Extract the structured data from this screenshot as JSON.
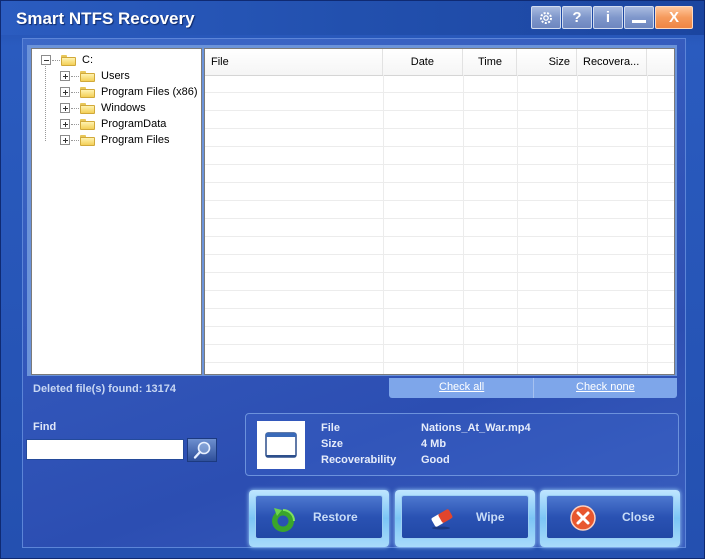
{
  "window": {
    "title": "Smart NTFS Recovery",
    "title_buttons": [
      {
        "name": "settings",
        "glyph": "⚙"
      },
      {
        "name": "help",
        "glyph": "?"
      },
      {
        "name": "info",
        "glyph": "i"
      },
      {
        "name": "minimize",
        "glyph": "_"
      },
      {
        "name": "close",
        "glyph": "X"
      }
    ]
  },
  "tree": {
    "root": {
      "label": "C:",
      "expanded": true
    },
    "children": [
      {
        "label": "Users"
      },
      {
        "label": "Program Files (x86)"
      },
      {
        "label": "Windows"
      },
      {
        "label": "ProgramData"
      },
      {
        "label": "Program Files"
      }
    ]
  },
  "grid": {
    "columns": [
      "File",
      "Date",
      "Time",
      "Size",
      "Recovera..."
    ],
    "rows": []
  },
  "status": {
    "deleted_found": "Deleted file(s) found: 13174"
  },
  "check": {
    "all": "Check all",
    "none": "Check none"
  },
  "find": {
    "label": "Find",
    "value": "",
    "placeholder": ""
  },
  "details": {
    "file_label": "File",
    "file_value": "Nations_At_War.mp4",
    "size_label": "Size",
    "size_value": "4 Mb",
    "recoverability_label": "Recoverability",
    "recoverability_value": "Good"
  },
  "actions": {
    "restore": "Restore",
    "wipe": "Wipe",
    "close": "Close"
  }
}
